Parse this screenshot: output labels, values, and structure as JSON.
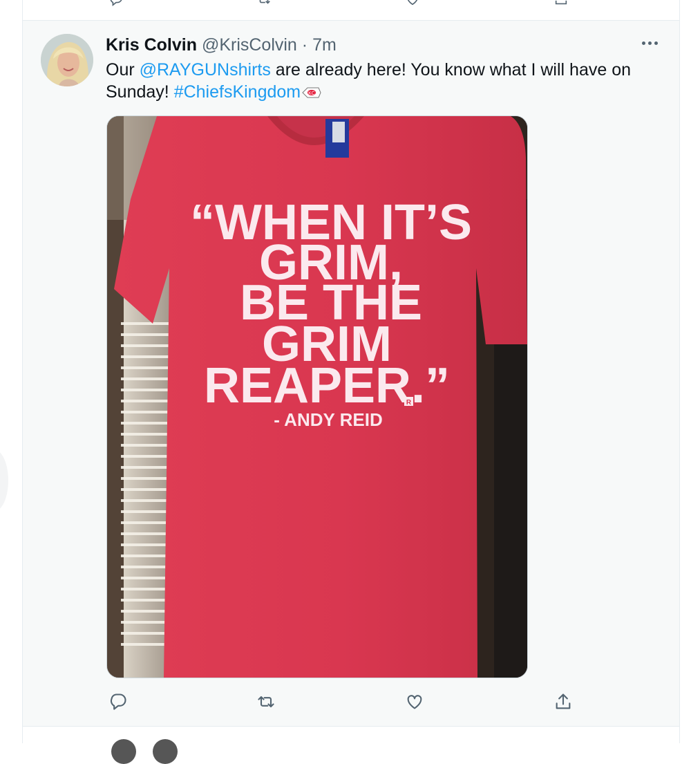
{
  "tweet": {
    "author": {
      "display_name": "Kris Colvin",
      "handle": "@KrisColvin",
      "separator": "·",
      "time": "7m"
    },
    "text": {
      "part1": "Our ",
      "mention": "@RAYGUNshirts",
      "part2": " are already here! You know what I will have on Sunday! ",
      "hashtag": "#ChiefsKingdom",
      "emoji": "chiefs-arrowhead-emoji"
    },
    "media": {
      "shirt_lines": [
        "“WHEN IT’S",
        "GRIM,",
        "BE THE",
        "GRIM",
        "REAPER.”"
      ],
      "attribution": "- ANDY REID",
      "logo_mark": "R"
    },
    "actions": [
      "reply-icon",
      "retweet-icon",
      "like-icon",
      "share-icon"
    ]
  },
  "colors": {
    "link": "#1d9bf0",
    "secondary_text": "#536471",
    "tweet_background": "#f7f9f9",
    "shirt_red": "#d9364e"
  }
}
